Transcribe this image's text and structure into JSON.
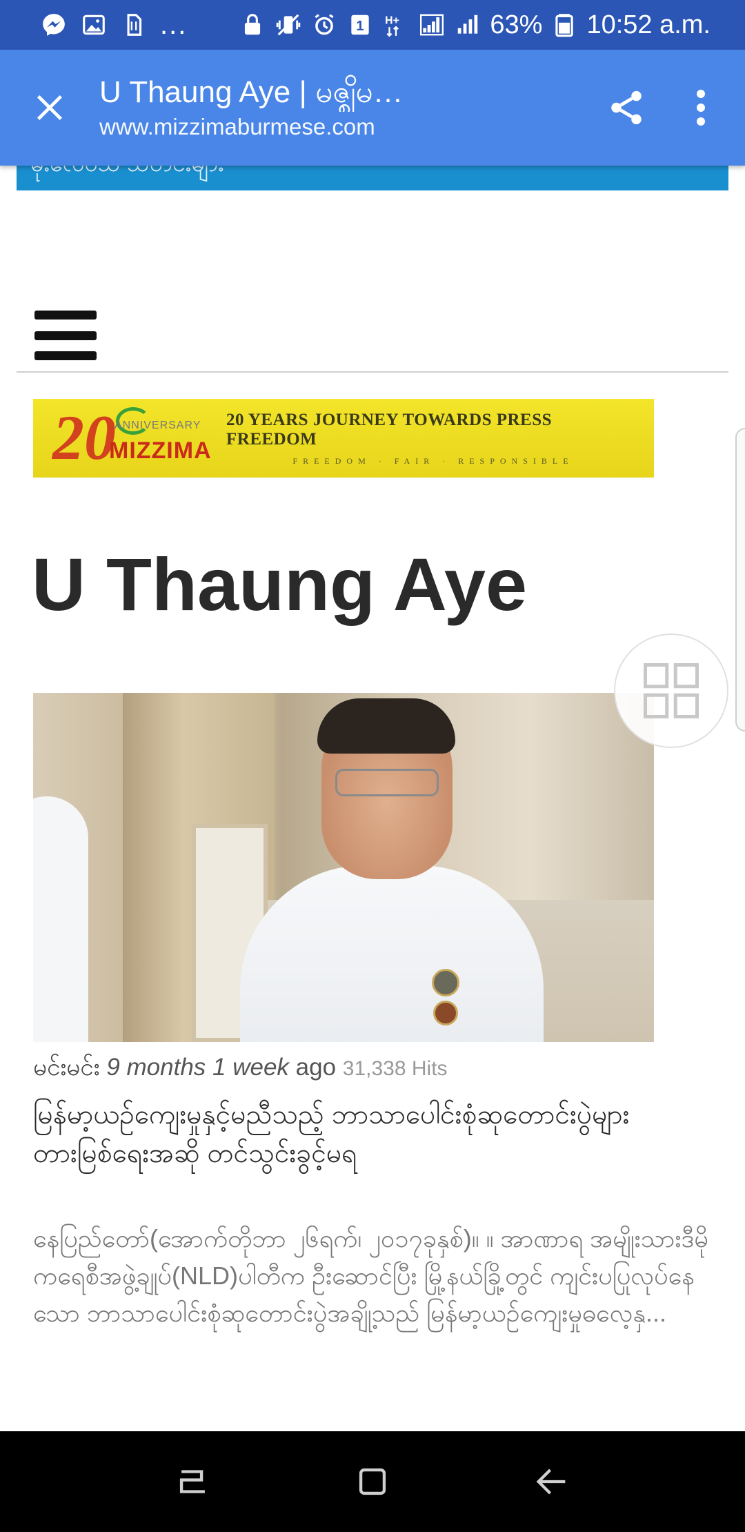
{
  "status_bar": {
    "overflow_dots": "...",
    "network_badge": "H+",
    "sim_badge": "1",
    "battery_percent": "63%",
    "time": "10:52 a.m.",
    "icons": [
      "messenger-icon",
      "gallery-icon",
      "sim-card-icon",
      "lock-icon",
      "vibrate-icon",
      "alarm-icon",
      "signal-icon",
      "battery-icon"
    ]
  },
  "toolbar": {
    "title": "U Thaung Aye | မဇ္ဈိမ…",
    "url": "www.mizzimaburmese.com",
    "icons": [
      "close-icon",
      "share-icon",
      "more-vert-icon"
    ]
  },
  "page": {
    "top_strip_text": "မိုးလေဝသ သတင်းများ",
    "banner": {
      "number": "20",
      "anniversary": "ANNIVERSARY",
      "brand": "MIZZIMA",
      "headline": "20 YEARS JOURNEY TOWARDS PRESS FREEDOM",
      "tagline": "FREEDOM · FAIR · RESPONSIBLE"
    },
    "heading": "U Thaung Aye",
    "article": {
      "author": "မင်းမင်း",
      "time": "9 months 1 week",
      "ago": "ago",
      "hits": "31,338 Hits",
      "title": "မြန်မာ့ယဉ်ကျေးမှုနှင့်မညီသည့် ဘာသာပေါင်းစုံဆုတောင်းပွဲများ တားမြစ်ရေးအဆို တင်သွင်းခွင့်မရ",
      "excerpt": "နေပြည်တော်(အောက်တိုဘာ ၂၆ရက်၊ ၂၀၁၇ခုနှစ်)။ ။ အာဏာရ အမျိုးသားဒီမိုကရေစီအဖွဲ့ချုပ်(NLD)ပါတီက ဦးဆောင်ပြီး မြို့နယ်ခြို့တွင် ကျင်းပပြုလုပ်နေသော ဘာသာပေါင်းစုံဆုတောင်းပွဲအချို့သည် မြန်မာ့ယဉ်ကျေးမှုဓလေ့နှ..."
    }
  },
  "floating": {
    "icon": "grid-view-icon"
  },
  "nav_bar": {
    "icons": [
      "recents-icon",
      "home-icon",
      "back-icon"
    ]
  },
  "colors": {
    "status_bar": "#2c56b5",
    "toolbar": "#4a86e8",
    "strip": "#1a8fd0",
    "banner": "#efe024",
    "nav_bar": "#000000"
  }
}
